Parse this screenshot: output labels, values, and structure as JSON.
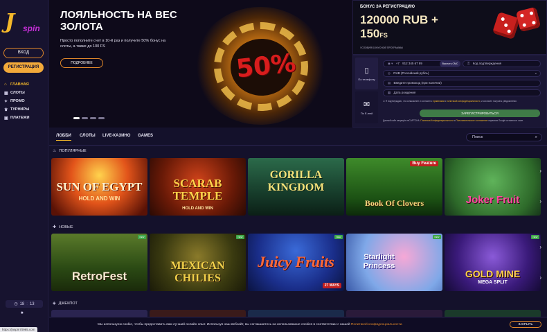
{
  "sidebar": {
    "logo_letter": "J",
    "logo_text": "spin",
    "login_label": "ВХОД",
    "register_label": "РЕГИСТРАЦИЯ",
    "nav": [
      {
        "label": "ГЛАВНАЯ",
        "icon": "home-icon",
        "active": true
      },
      {
        "label": "СЛОТЫ",
        "icon": "slots-icon"
      },
      {
        "label": "ПРОМО",
        "icon": "promo-icon"
      },
      {
        "label": "ТУРНИРЫ",
        "icon": "trophy-icon"
      },
      {
        "label": "ПЛАТЕЖИ",
        "icon": "wallet-icon"
      }
    ],
    "clock_hours": "18",
    "clock_minutes": "13"
  },
  "status_url": "https://jnspin70965.com",
  "hero": {
    "title": "ЛОЯЛЬНОСТЬ НА ВЕС ЗОЛОТА",
    "description": "Просто пополните счет в 10-й раз и получите 50% бонус на слоты, а также до 100 FS",
    "button_label": "ПОДРОБНЕЕ",
    "badge_text": "50%",
    "slides": 4,
    "active_slide": 1
  },
  "bonus": {
    "label": "БОНУС ЗА РЕГИСТРАЦИЮ",
    "amount": "120000 RUB +",
    "fs_number": "150",
    "fs_suffix": "FS",
    "terms": "УСЛОВИЯ БОНУСНОЙ ПРОГРАММЫ"
  },
  "registration": {
    "tab_phone": "По телефону",
    "tab_email": "По E-mail",
    "phone_prefix": "+7",
    "phone_value": "912 345 67 89",
    "sms_button": "Выслать СМС",
    "code_placeholder": "Код подтверждения",
    "currency": "RUB (Российский рубль)",
    "promo_placeholder": "Введите промокод (при наличии)",
    "birthdate_placeholder": "Дата рождения",
    "consent_text": "Я подтверждаю, что ознакомлен и согласен с ",
    "consent_link1": "правилами",
    "consent_mid": " и ",
    "consent_link2": "политикой конфиденциальности",
    "consent_tail": ", и согласен получать уведомления",
    "register_button": "ЗАРЕГИСТРИРОВАТЬСЯ",
    "recaptcha_text": "Данный сайт защищён reCAPTCHA. ",
    "recaptcha_link1": "Политика Конфиденциальности",
    "recaptcha_mid": " и ",
    "recaptcha_link2": "Пользовательское соглашение",
    "recaptcha_tail": " сервисов Google остаются в силе."
  },
  "game_tabs": {
    "tabs": [
      "ЛОББИ",
      "СЛОТЫ",
      "LIVE-КАЗИНО",
      "GAMES"
    ],
    "active": 0,
    "search_placeholder": "Поиск"
  },
  "sections": {
    "popular": {
      "title": "ПОПУЛЯРНЫЕ",
      "games": [
        {
          "name": "SUN OF EGYPT",
          "sub": "HOLD AND WIN"
        },
        {
          "name": "SCARAB TEMPLE",
          "sub": "HOLD AND WIN"
        },
        {
          "name": "GORILLA KINGDOM",
          "sub": ""
        },
        {
          "name": "Book Of Clovers",
          "sub": "Buy Feature"
        },
        {
          "name": "Joker Fruit",
          "sub": ""
        }
      ]
    },
    "new": {
      "title": "НОВЫЕ",
      "new_badge": "NEW",
      "games": [
        {
          "name": "RetroFest",
          "sub": ""
        },
        {
          "name": "MEXICAN CHILIES",
          "sub": ""
        },
        {
          "name": "Juicy Fruits",
          "sub": "27 WAYS"
        },
        {
          "name": "Starlight Princess",
          "sub": ""
        },
        {
          "name": "GOLD MINE",
          "sub": "MEGA SPLIT"
        }
      ]
    },
    "jackpot": {
      "title": "ДЖЕКПОТ"
    }
  },
  "cookie": {
    "text": "Мы используем cookie, чтобы предоставить вам лучший онлайн опыт. Используя наш вебсайт, вы соглашаетесь на использование cookies в соответствии с нашей ",
    "link": "Политикой конфиденциальности.",
    "close_button": "ЗАКРЫТЬ"
  },
  "colors": {
    "accent": "#f2a93a",
    "background": "#14112b",
    "sidebar": "#17132f",
    "register_green": "#3f7b47"
  }
}
